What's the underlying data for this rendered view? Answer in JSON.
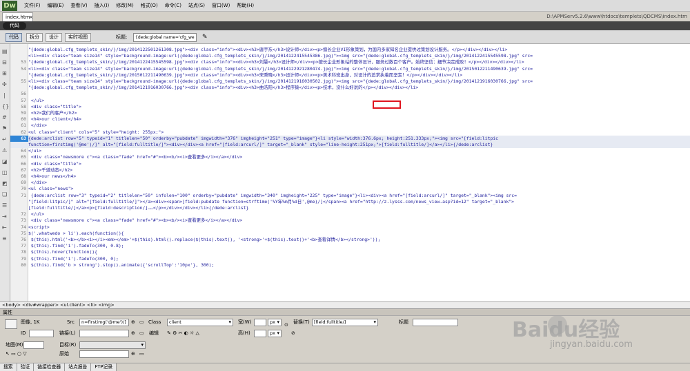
{
  "app": {
    "logo": "Dw",
    "menus": [
      "文件(F)",
      "编辑(E)",
      "查看(V)",
      "插入(I)",
      "修改(M)",
      "格式(O)",
      "命令(C)",
      "站点(S)",
      "窗口(W)",
      "帮助(H)"
    ]
  },
  "doc": {
    "tab": "index.htm",
    "close": "×",
    "path": "D:\\APMServ5.2.6\\www\\htdocs\\templets\\QDCMS\\index.htm"
  },
  "strip": {
    "label": "代码"
  },
  "toolbar": {
    "buttons": [
      "代码",
      "拆分",
      "设计",
      "实时视图"
    ],
    "title_label": "标题:",
    "title_value": "{dede:global name='cfg_we"
  },
  "code": {
    "highlight_line": "63",
    "lines": [
      {
        "n": "",
        "t": "\"{dede:global.cfg_templets_skin/}/img/2014122501261308.jpg\"><div class=\"info\"><div><h3>唐宇东</h3>设计师</div><p>擅长企业VI形象策划，为国内多家知名企业提供过策划设计服务。</p></div></div></li>"
      },
      {
        "n": "",
        "t": "<li><div class=\"team size14\" style=\"background-image:url({dede:global.cfg_templets_skin/}/img/2014122415545386.jpg)\"><img  src=\"{dede:global.cfg_templets_skin/}/img/2014122415545598.jpg\" src="
      },
      {
        "n": "53",
        "t": "\"{dede:global.cfg_templets_skin/}/img/2014122415545598.jpg\"><div class=\"info\"><div><h3>刘慧</h3>设计师</div><p>擅长企业形象站的整体设计，服务过数百个客户。始终坚信：细节决定成败！</p></div></div></li>"
      },
      {
        "n": "54",
        "t": "<li><div class=\"team size14\" style=\"background-image:url({dede:global.cfg_templets_skin/}/img/2014122921280474.jpg)\"><img  src=\"{dede:global.cfg_templets_skin/}/img/2015012211490639.jpg\" src="
      },
      {
        "n": "",
        "t": "\"{dede:global.cfg_templets_skin/}/img/2015012211490639.jpg\"><div class=\"info\"><div><h3>宋秉晓</h3>设计师</div><p>美术科班出身，对设计的追求执着而坚定！</p></div></div></li>"
      },
      {
        "n": "55",
        "t": "<li><div class=\"team size14\" style=\"background-image:url({dede:global.cfg_templets_skin/}/img/2014121916030502.jpg)\"><img src=\"{dede:global.cfg_templets_skin/}/img/2014121916030766.jpg\" src="
      },
      {
        "n": "",
        "t": "\"{dede:global.cfg_templets_skin/}/img/2014121916030766.jpg\"><div class=\"info\"><div><h3>曲浩阳</h3>程序猿</div><p>技术，没什么好说的</p></div></div></li>"
      },
      {
        "n": "56",
        "t": ""
      },
      {
        "n": "57",
        "t": "        </ul>"
      },
      {
        "n": "58",
        "t": "        <div class=\"title\">"
      },
      {
        "n": "59",
        "t": "            <h2>我们的客户</h2>"
      },
      {
        "n": "60",
        "t": "            <h4>our client</h4>"
      },
      {
        "n": "61",
        "t": "        </div>"
      },
      {
        "n": "62",
        "t": "<ul class=\"client\" cols=\"5\" style=\"height: 255px;\">"
      },
      {
        "n": "63",
        "t": "{dede:arclist row=\"5\" typeid=\"1\" titlelen=\"50\" orderby=\"pubdate\" imgwidth=\"376\" imgheight=\"251\" type=\"image\"}<li style=\"width:376.6px; height:251.333px;\"><img src=\"[field:litpic"
      },
      {
        "n": "",
        "t": "function=firstimg('@me')/]\" alt=\"[field:fulltitle/]\"><div></div><a href=\"[field:arcurl/]\" target=\"_blank\" style=\"line-height:251px;\">[field:fulltitle/]</a></li>{/dede:arclist}"
      },
      {
        "n": "64",
        "t": "</ul>"
      },
      {
        "n": "65",
        "t": "        <div class=\"newsmore c\"><a class=\"fade\" href=\"#\"><b><b/><i>查看更多</i></a></div>"
      },
      {
        "n": "66",
        "t": "        <div class=\"title\">"
      },
      {
        "n": "67",
        "t": "            <h2>千道动态</h2>"
      },
      {
        "n": "68",
        "t": "            <h4>our news</h4>"
      },
      {
        "n": "69",
        "t": "        </div>"
      },
      {
        "n": "70",
        "t": "<ul class=\"news\">"
      },
      {
        "n": "71",
        "t": "        {dede:arclist row=\"3\" typeid=\"2\" titlelen=\"50\" infolen=\"100\" orderby=\"pubdate\" imgwidth=\"340\" imgheight=\"225\" type=\"image\"}<li><div><a href=\"[field:arcurl/]\" target=\"_blank\"><img src="
      },
      {
        "n": "",
        "t": "\"[field:litpic/]\" alt=\"[field:fulltitle/]\"></a><div><span>[field:pubdate function=strftime('%Y年%m月%d日',@me)/]</span><a href=\"http://z.lysss.com/news_view.asp?id=12\" target=\"_blank\">"
      },
      {
        "n": "",
        "t": "[field:fulltitle/]</a><p>[field:description/]……</p></div></div></li>{/dede:arclist}"
      },
      {
        "n": "72",
        "t": "        </ul>"
      },
      {
        "n": "73",
        "t": "        <div class=\"newsmore c\"><a class=\"fade\" href=\"#\"><b><b/><i>查看更多</i></a></div>"
      },
      {
        "n": "74",
        "t": "<script>"
      },
      {
        "n": "75",
        "t": "$('.whatwedo > li').each(function(){"
      },
      {
        "n": "76",
        "t": "    $(this).html('<b></b><i></i><em></em>'+$(this).html().replace($(this).text(), '<strong>'+$(this).text()+'<b>查看详情</b></strong>'));"
      },
      {
        "n": "77",
        "t": "    $(this).find('i').fadeTo(300, 0.8);"
      },
      {
        "n": "78",
        "t": "    $(this).hover(function(){"
      },
      {
        "n": "79",
        "t": "        $(this).find('i').fadeTo(300, 0);"
      },
      {
        "n": "80",
        "t": "        $(this).find('b > strong').stop().animate({'scrollTop':'10px'}, 300);"
      }
    ]
  },
  "tagbar": "<body> <div#wrapper> <ul.client> <li> <img>",
  "props": {
    "header": "属性",
    "img_label": "图像, 1K",
    "id_label": "ID",
    "src_label": "Src",
    "src_value": "n=firstimg('@me')/]",
    "link_label": "链接(L)",
    "edit_label": "编辑",
    "class_label": "Class",
    "class_value": "client",
    "width_label": "宽(W)",
    "height_label": "高(H)",
    "unit": "px",
    "alt_label": "替换(T)",
    "alt_value": "[field:fulltitle/]",
    "title_label": "标题",
    "map_label": "地图(M)",
    "target_label": "目标(R)",
    "orig_label": "原始"
  },
  "bottom_tabs": [
    "搜索",
    "验证",
    "链接检查器",
    "站点报告",
    "FTP记录"
  ],
  "watermark": {
    "brand": "Baidu经验",
    "url": "jingyan.baidu.com"
  }
}
